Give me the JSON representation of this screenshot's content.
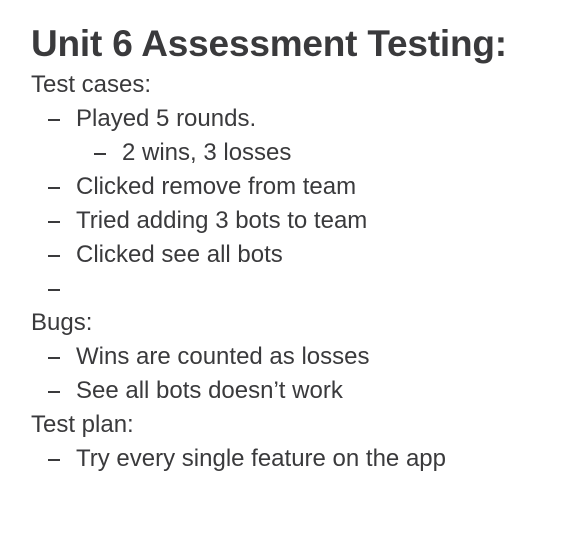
{
  "note": {
    "title": "Unit 6 Assessment Testing:",
    "sections": [
      {
        "heading": "Test cases:",
        "items": [
          {
            "text": "Played 5 rounds.",
            "level": 1
          },
          {
            "text": "2 wins, 3 losses",
            "level": 2
          },
          {
            "text": "Clicked remove from team",
            "level": 1
          },
          {
            "text": "Tried adding 3 bots to team",
            "level": 1
          },
          {
            "text": "Clicked see all bots",
            "level": 1
          },
          {
            "text": "",
            "level": 1
          }
        ]
      },
      {
        "heading": "Bugs:",
        "items": [
          {
            "text": "Wins are counted as losses",
            "level": 1
          },
          {
            "text": "See all bots doesn’t work",
            "level": 1
          }
        ]
      },
      {
        "heading": "Test plan:",
        "items": [
          {
            "text": "Try every single feature on the app",
            "level": 1
          }
        ]
      }
    ]
  }
}
